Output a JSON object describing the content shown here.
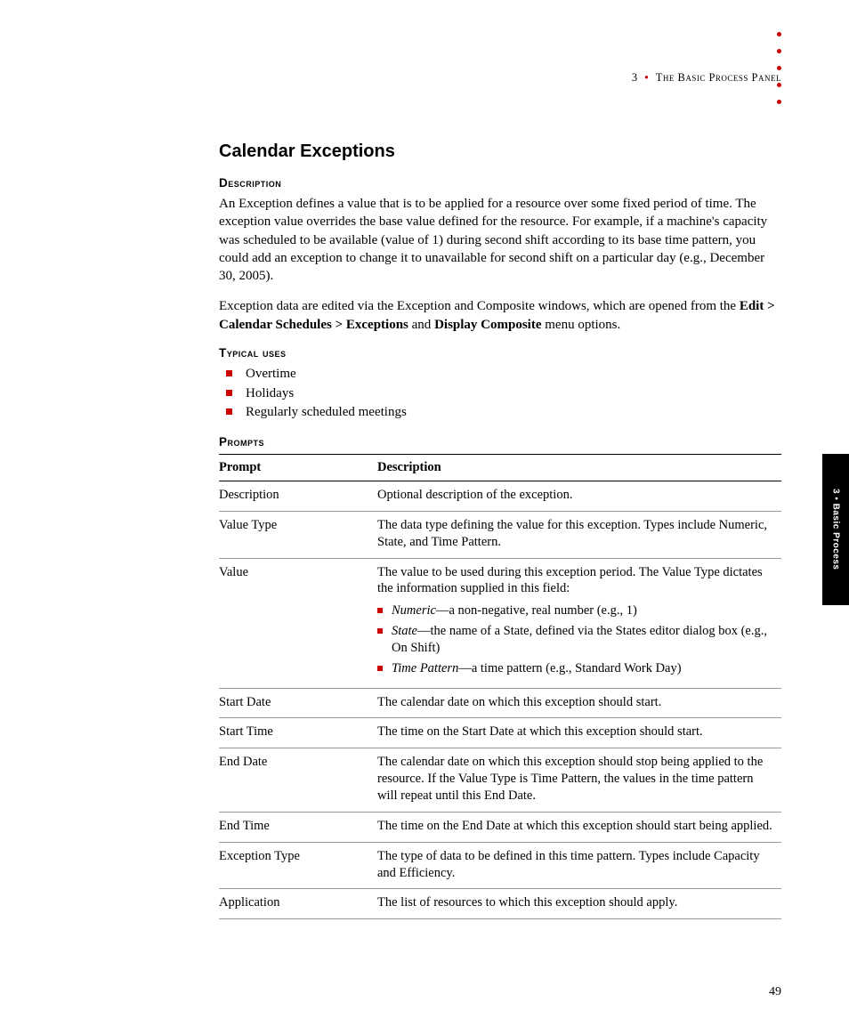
{
  "header": {
    "chapter_number": "3",
    "chapter_title": "The Basic Process Panel"
  },
  "side_tab": "3 • Basic Process",
  "page_number": "49",
  "section": {
    "title": "Calendar Exceptions",
    "description_head": "Description",
    "description_p1": "An Exception defines a value that is to be applied for a resource over some fixed period of time. The exception value overrides the base value defined for the resource. For example, if a machine's capacity was scheduled to be available (value of 1) during second shift according to its base time pattern, you could add an exception to change it to unavailable for second shift on a particular day (e.g., December 30, 2005).",
    "description_p2_pre": "Exception data are edited via the Exception and Composite windows, which are opened from the ",
    "description_p2_b1": "Edit > Calendar Schedules > Exceptions",
    "description_p2_mid": " and ",
    "description_p2_b2": "Display Composite",
    "description_p2_post": " menu options.",
    "typical_head": "Typical uses",
    "typical_uses": [
      "Overtime",
      "Holidays",
      "Regularly scheduled meetings"
    ],
    "prompts_head": "Prompts",
    "table": {
      "col1": "Prompt",
      "col2": "Description",
      "rows": {
        "description": {
          "p": "Description",
          "d": "Optional description of the exception."
        },
        "value_type": {
          "p": "Value Type",
          "d": "The data type defining the value for this exception. Types include Numeric, State, and Time Pattern."
        },
        "value": {
          "p": "Value",
          "d_intro": "The value to be used during this exception period. The Value Type dictates the information supplied in this field:",
          "items": [
            {
              "em": "Numeric",
              "rest": "—a non-negative, real number (e.g., 1)"
            },
            {
              "em": "State",
              "rest": "—the name of a State, defined via the States editor dialog box (e.g., On Shift)"
            },
            {
              "em": "Time Pattern",
              "rest": "—a time pattern (e.g., Standard Work Day)"
            }
          ]
        },
        "start_date": {
          "p": "Start Date",
          "d": "The calendar date on which this exception should start."
        },
        "start_time": {
          "p": "Start Time",
          "d": "The time on the Start Date at which this exception should start."
        },
        "end_date": {
          "p": "End Date",
          "d": "The calendar date on which this exception should stop being applied to the resource. If the Value Type is Time Pattern, the values in the time pattern will repeat until this End Date."
        },
        "end_time": {
          "p": "End Time",
          "d": "The time on the End Date at which this exception should start being applied."
        },
        "exception_type": {
          "p": "Exception Type",
          "d": "The type of data to be defined in this time pattern. Types include Capacity and Efficiency."
        },
        "application": {
          "p": "Application",
          "d": "The list of resources to which this exception should apply."
        }
      }
    }
  }
}
